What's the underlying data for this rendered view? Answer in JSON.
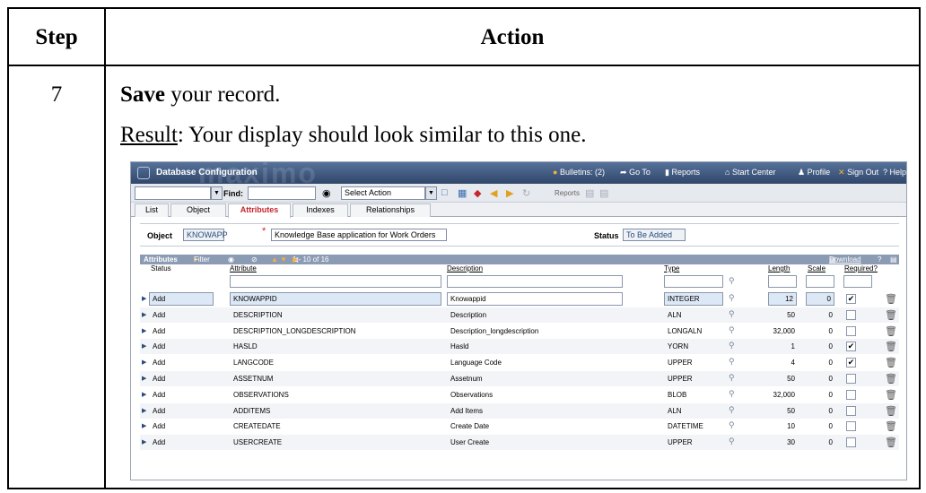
{
  "doc": {
    "header_step": "Step",
    "header_action": "Action",
    "step_number": "7",
    "instruction_bold": "Save",
    "instruction_rest": " your record.",
    "result_label": "Result",
    "result_rest": ": Your display should look similar to this one."
  },
  "app": {
    "title": "Database Configuration",
    "watermark": "maximo",
    "nav": {
      "bulletins": "Bulletins: (2)",
      "goto": "Go To",
      "reports": "Reports",
      "start_center": "Start Center",
      "profile": "Profile",
      "sign_out": "Sign Out",
      "help": "Help"
    },
    "toolbar": {
      "find_label": "Find:",
      "select_action": "Select Action",
      "reports_label": "Reports"
    },
    "tabs": [
      "List",
      "Object",
      "Attributes",
      "Indexes",
      "Relationships"
    ],
    "active_tab": "Attributes",
    "object": {
      "label": "Object",
      "value": "KNOWAPP",
      "description": "Knowledge Base application for Work Orders",
      "status_label": "Status",
      "status_value": "To Be Added"
    },
    "section": {
      "title": "Attributes",
      "filter": "Filter",
      "pager": "1 - 10 of 16",
      "download": "Download",
      "help": "?"
    },
    "columns": [
      "Status",
      "Attribute",
      "Description",
      "Type",
      "Length",
      "Scale",
      "Required?"
    ],
    "rows": [
      {
        "status": "Add",
        "attribute": "KNOWAPPID",
        "description": "Knowappid",
        "type": "INTEGER",
        "length": "12",
        "scale": "0",
        "required": true,
        "selected": true
      },
      {
        "status": "Add",
        "attribute": "DESCRIPTION",
        "description": "Description",
        "type": "ALN",
        "length": "50",
        "scale": "0",
        "required": false
      },
      {
        "status": "Add",
        "attribute": "DESCRIPTION_LONGDESCRIPTION",
        "description": "Description_longdescription",
        "type": "LONGALN",
        "length": "32,000",
        "scale": "0",
        "required": false
      },
      {
        "status": "Add",
        "attribute": "HASLD",
        "description": "Hasld",
        "type": "YORN",
        "length": "1",
        "scale": "0",
        "required": true
      },
      {
        "status": "Add",
        "attribute": "LANGCODE",
        "description": "Language Code",
        "type": "UPPER",
        "length": "4",
        "scale": "0",
        "required": true
      },
      {
        "status": "Add",
        "attribute": "ASSETNUM",
        "description": "Assetnum",
        "type": "UPPER",
        "length": "50",
        "scale": "0",
        "required": false
      },
      {
        "status": "Add",
        "attribute": "OBSERVATIONS",
        "description": "Observations",
        "type": "BLOB",
        "length": "32,000",
        "scale": "0",
        "required": false
      },
      {
        "status": "Add",
        "attribute": "ADDITEMS",
        "description": "Add Items",
        "type": "ALN",
        "length": "50",
        "scale": "0",
        "required": false
      },
      {
        "status": "Add",
        "attribute": "CREATEDATE",
        "description": "Create Date",
        "type": "DATETIME",
        "length": "10",
        "scale": "0",
        "required": false
      },
      {
        "status": "Add",
        "attribute": "USERCREATE",
        "description": "User Create",
        "type": "UPPER",
        "length": "30",
        "scale": "0",
        "required": false
      }
    ]
  }
}
